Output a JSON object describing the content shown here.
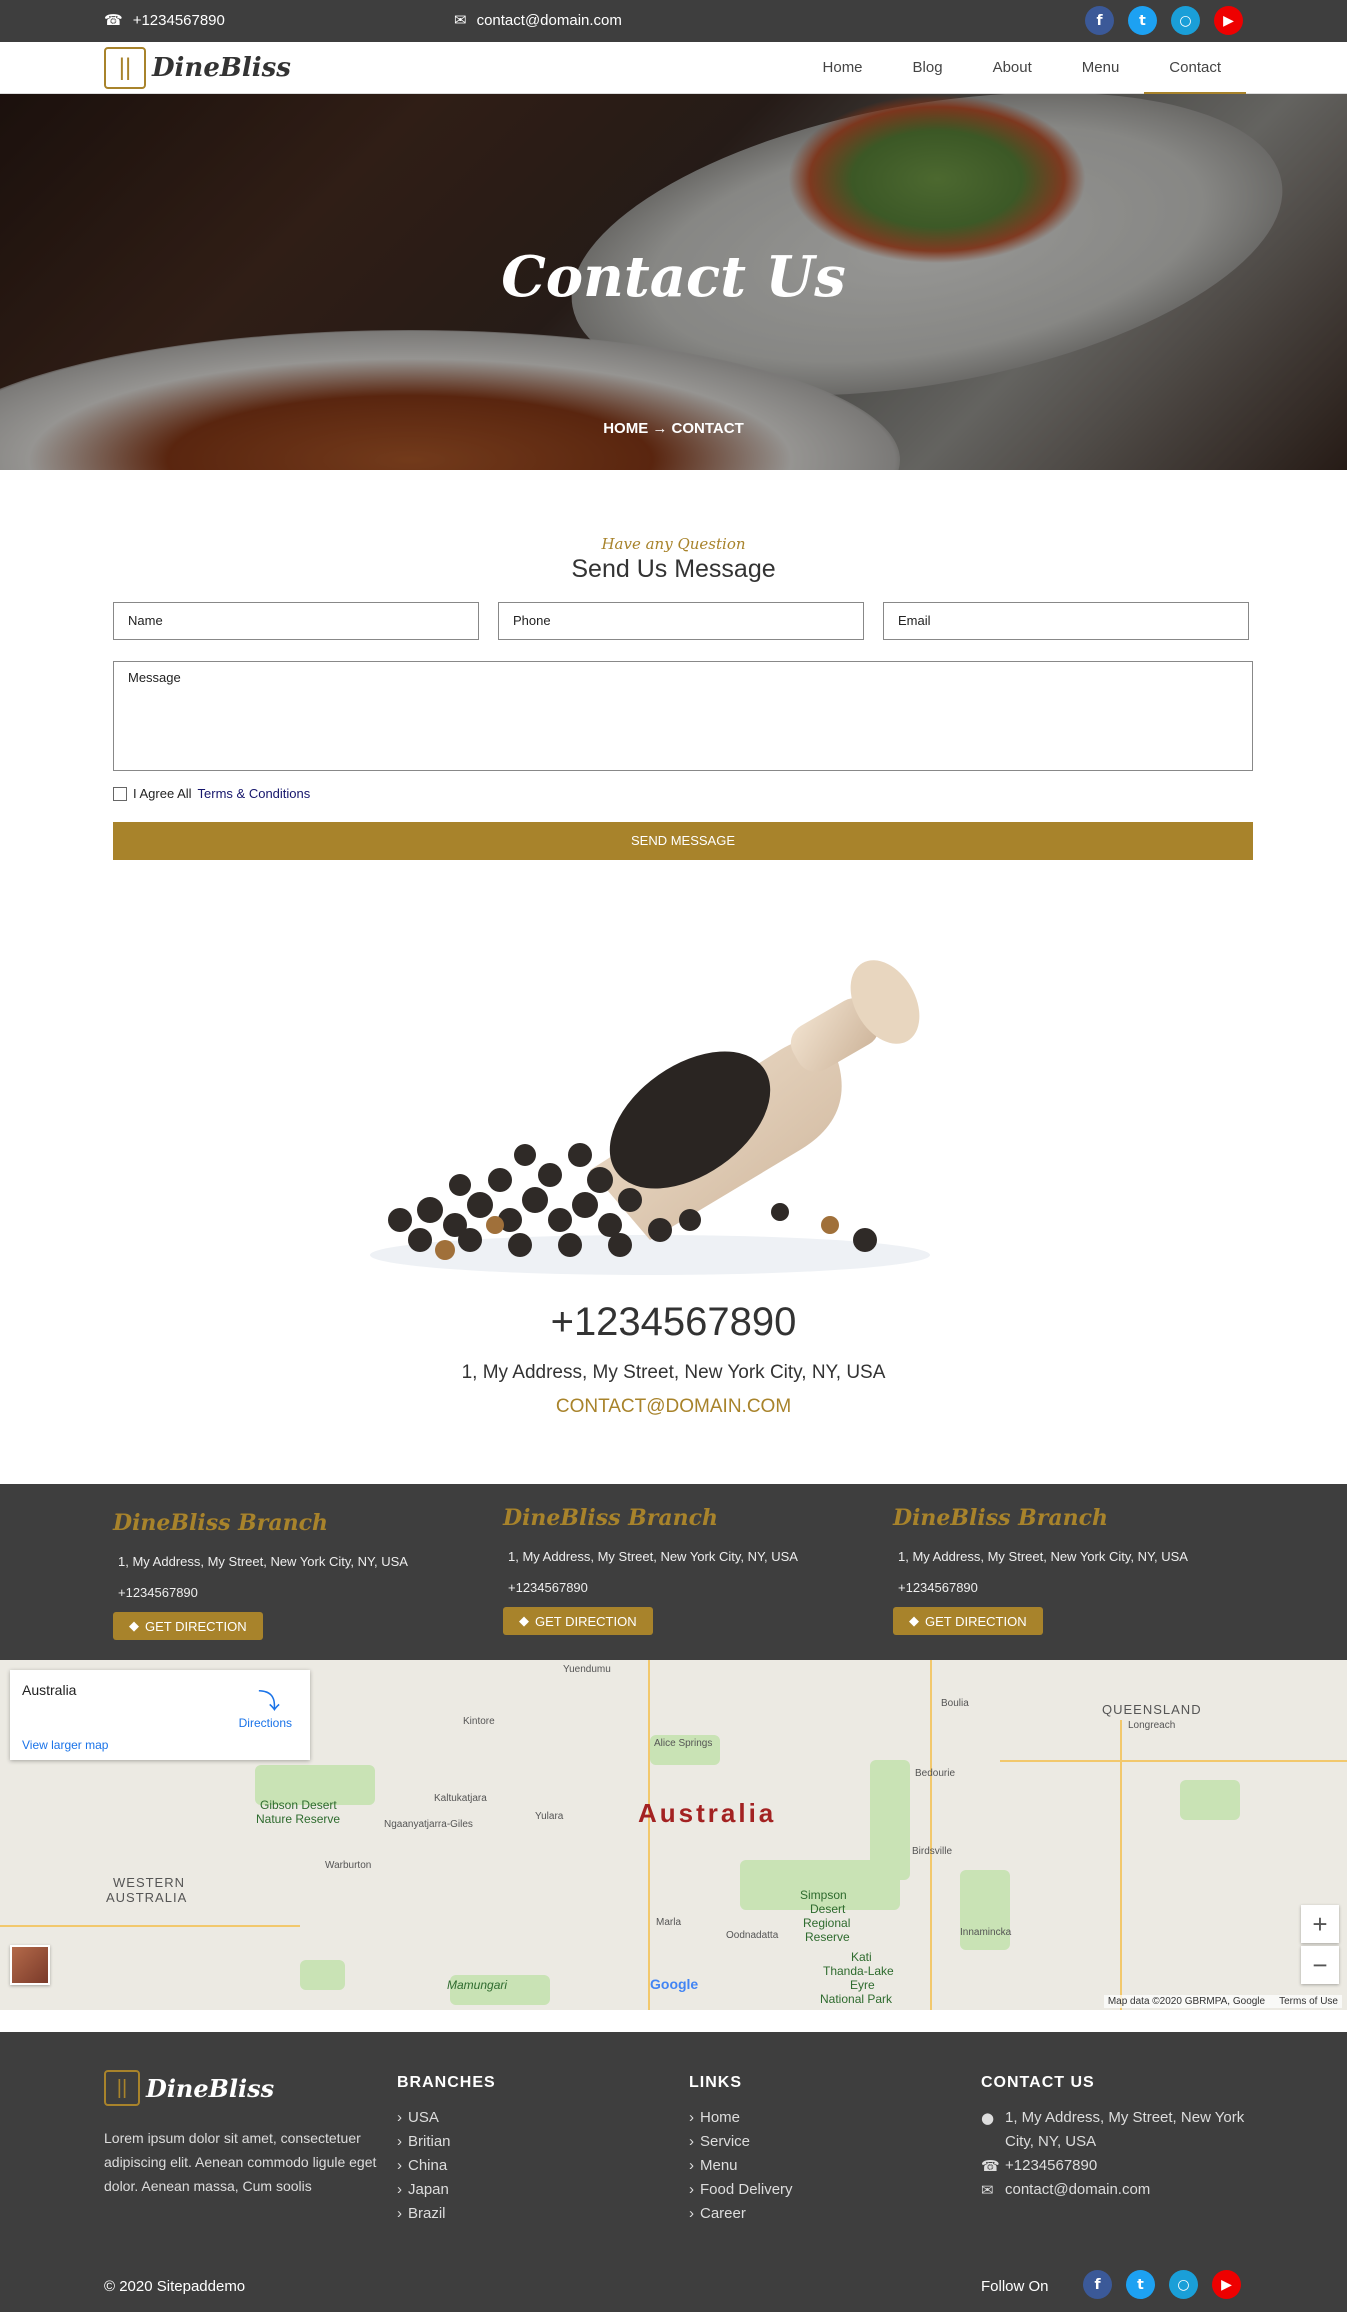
{
  "topbar": {
    "phone": "+1234567890",
    "email": "contact@domain.com",
    "social": [
      "facebook-icon",
      "twitter-icon",
      "instagram-icon",
      "youtube-icon"
    ]
  },
  "brand": {
    "name": "DineBliss",
    "accent": "#a8832b",
    "dark": "#3e3e3e"
  },
  "nav": {
    "items": [
      "Home",
      "Blog",
      "About",
      "Menu",
      "Contact"
    ],
    "active": "Contact"
  },
  "hero": {
    "title": "Contact Us",
    "breadcrumb": "HOME → CONTACT"
  },
  "form": {
    "subtitle": "Have any Question",
    "title": "Send Us Message",
    "name_placeholder": "Name",
    "phone_placeholder": "Phone",
    "email_placeholder": "Email",
    "message_placeholder": "Message",
    "agree_text": "I Agree All",
    "terms_text": "Terms & Conditions",
    "send_label": "SEND MESSAGE"
  },
  "contact": {
    "phone": "+1234567890",
    "address": "1, My Address, My Street, New York City, NY, USA",
    "email": "CONTACT@DOMAIN.COM"
  },
  "branches": [
    {
      "title": "DineBliss Branch",
      "address": "1, My Address, My Street, New York City, NY, USA",
      "phone": "+1234567890",
      "button": "GET DIRECTION"
    },
    {
      "title": "DineBliss Branch",
      "address": "1, My Address, My Street, New York City, NY, USA",
      "phone": "+1234567890",
      "button": "GET DIRECTION"
    },
    {
      "title": "DineBliss Branch",
      "address": "1, My Address, My Street, New York City, NY, USA",
      "phone": "+1234567890",
      "button": "GET DIRECTION"
    }
  ],
  "map": {
    "place": "Australia",
    "directions": "Directions",
    "view_larger": "View larger map",
    "big_label": "Australia",
    "labels": {
      "queensland": "QUEENSLAND",
      "western": "WESTERN",
      "australia": "AUSTRALIA",
      "gibson": "Gibson Desert",
      "gibson2": "Nature Reserve",
      "simpson": "Simpson",
      "simpson2": "Desert",
      "simpson3": "Regional",
      "simpson4": "Reserve",
      "kati": "Kati",
      "kati2": "Thanda-Lake",
      "kati3": "Eyre",
      "kati4": "National Park",
      "mamungari": "Mamungari",
      "yuendumu": "Yuendumu",
      "kintore": "Kintore",
      "alice": "Alice Springs",
      "boulia": "Boulia",
      "longreach": "Longreach",
      "bedourie": "Bedourie",
      "kaltukatjara": "Kaltukatjara",
      "ngaanyatjarra": "Ngaanyatjarra-Giles",
      "yulara": "Yulara",
      "birdsville": "Birdsville",
      "warburton": "Warburton",
      "marla": "Marla",
      "oodnadatta": "Oodnadatta",
      "innamincka": "Innamincka"
    },
    "google": "Google",
    "data_credit": "Map data ©2020 GBRMPA, Google",
    "terms": "Terms of Use",
    "zoom_in": "+",
    "zoom_out": "−"
  },
  "footer": {
    "description": "Lorem ipsum dolor sit amet, consectetuer adipiscing elit. Aenean commodo ligule eget dolor. Aenean massa, Cum soolis",
    "branches_title": "BRANCHES",
    "branches": [
      "USA",
      "Britian",
      "China",
      "Japan",
      "Brazil"
    ],
    "links_title": "LINKS",
    "links": [
      "Home",
      "Service",
      "Menu",
      "Food Delivery",
      "Career"
    ],
    "contact_title": "CONTACT US",
    "contact_address_1": "1, My Address, My Street, New York",
    "contact_address_2": "City, NY, USA",
    "contact_phone": "+1234567890",
    "contact_email": "contact@domain.com",
    "copyright": "© 2020 Sitepaddemo",
    "follow": "Follow On"
  }
}
